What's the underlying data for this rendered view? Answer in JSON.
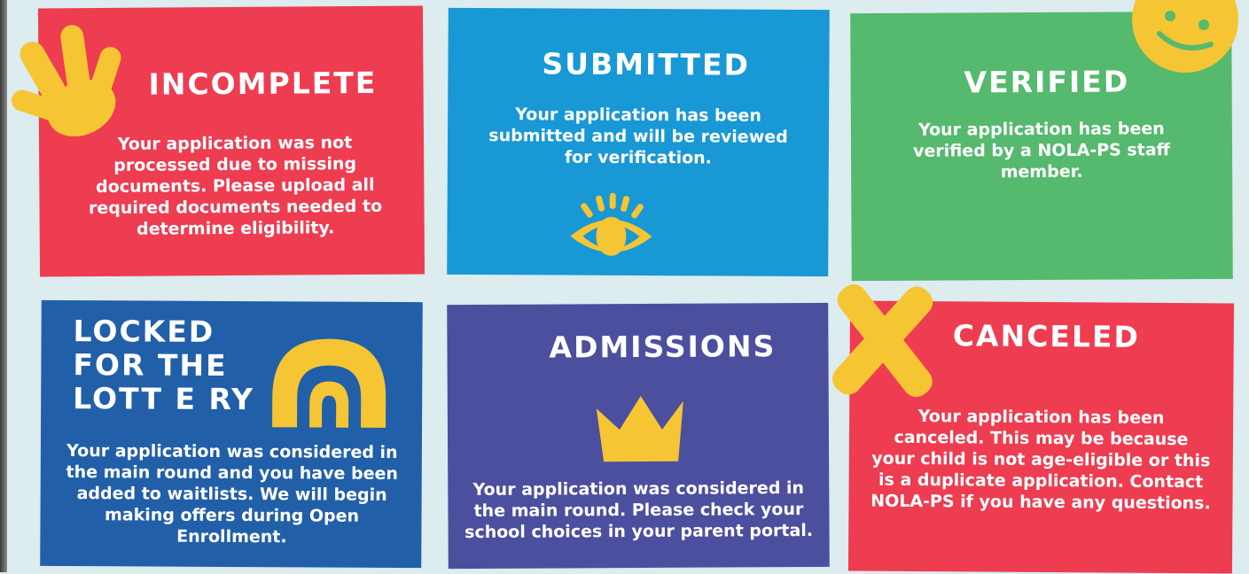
{
  "colors": {
    "background": "#dcecef",
    "red": "#ee3c50",
    "sky_blue": "#1898d5",
    "green": "#55b96e",
    "royal_blue": "#215fa9",
    "indigo": "#4c4f9e",
    "yellow": "#f6c533"
  },
  "cards": [
    {
      "title": "INCOMPLETE",
      "body": "Your application was not processed due to missing documents. Please upload all required documents needed to determine eligibility.",
      "color": "#ee3c50",
      "icon": "hand-icon"
    },
    {
      "title": "SUBMITTED",
      "body": "Your application has been submitted and will be reviewed for verification.",
      "color": "#1898d5",
      "icon": "eye-icon"
    },
    {
      "title": "VERIFIED",
      "body": "Your application has been verified by a NOLA-PS staff member.",
      "color": "#55b96e",
      "icon": "smiley-icon"
    },
    {
      "title_lines": [
        "LOCKED",
        "FOR THE",
        "LOTT E RY"
      ],
      "body": "Your application was considered in the main round and you have been added to waitlists. We will begin making offers during Open Enrollment.",
      "color": "#215fa9",
      "icon": "rainbow-icon"
    },
    {
      "title": "ADMISSIONS",
      "body": "Your application was considered in the main round. Please check your school choices in your parent portal.",
      "color": "#4c4f9e",
      "icon": "crown-icon"
    },
    {
      "title": "CANCELED",
      "body": "Your application has been canceled. This may be because your child is not age-eligible or this is a duplicate application. Contact NOLA-PS if you have any questions.",
      "color": "#ee3c50",
      "icon": "x-mark-icon"
    }
  ]
}
